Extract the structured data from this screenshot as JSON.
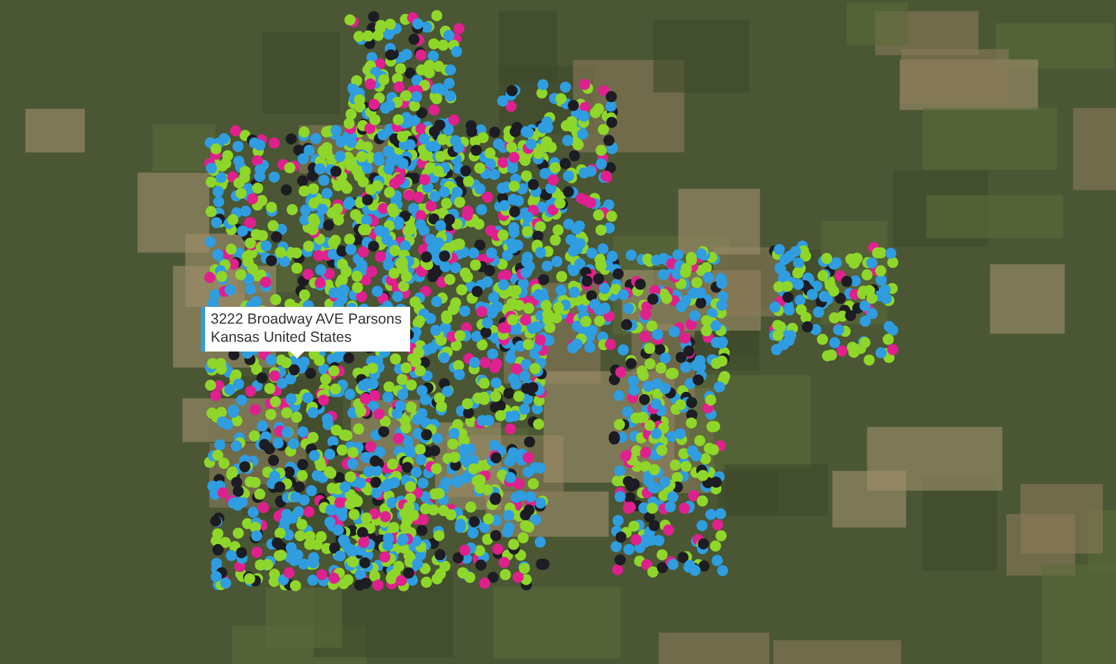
{
  "map": {
    "tooltip": {
      "lines": [
        "3222 Broadway AVE Parsons",
        "Kansas United States"
      ]
    }
  }
}
